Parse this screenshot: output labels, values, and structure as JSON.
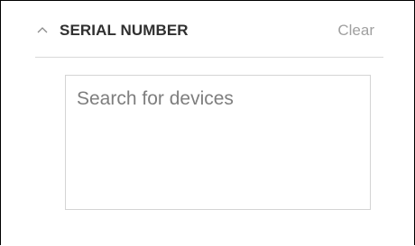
{
  "filter": {
    "title": "SERIAL NUMBER",
    "clear_label": "Clear",
    "collapse_icon": "chevron-up-icon",
    "search": {
      "placeholder": "Search for devices",
      "value": ""
    }
  },
  "colors": {
    "title": "#303030",
    "clear": "#a0a0a0",
    "divider": "#d8d8d8",
    "input_border": "#d4d4d4",
    "placeholder": "#7e7e7e"
  }
}
